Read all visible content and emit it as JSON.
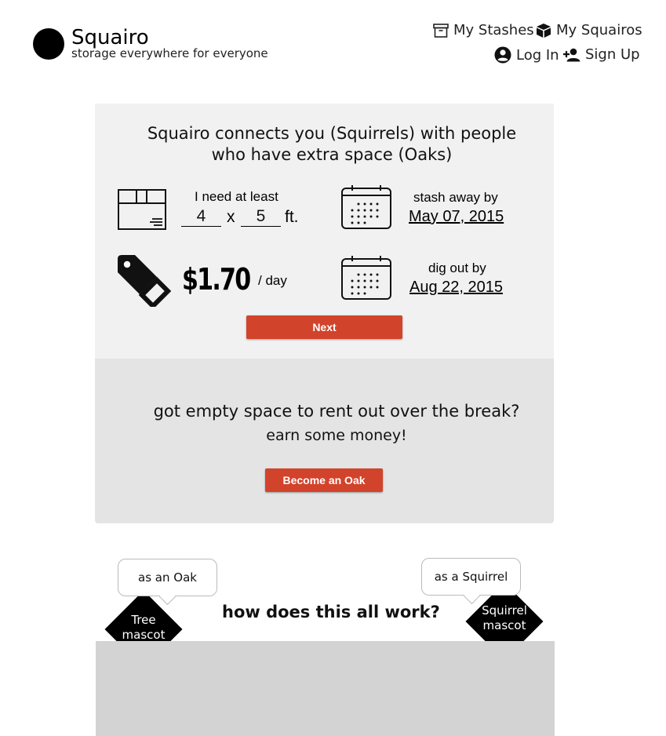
{
  "header": {
    "brand": "Squairo",
    "tagline": "storage everywhere for everyone",
    "nav": {
      "stashes": "My Stashes",
      "squairos": "My Squairos",
      "login": "Log In",
      "signup": "Sign Up"
    }
  },
  "hero": {
    "headline_line1": "Squairo connects you (Squirrels) with people",
    "headline_line2": "who have extra space (Oaks)",
    "size": {
      "label": "I need at least",
      "width": "4",
      "by": "x",
      "length": "5",
      "unit": "ft."
    },
    "price": {
      "amount": "$1.70",
      "period": "/ day"
    },
    "stash": {
      "label": "stash away by",
      "date": "May 07, 2015"
    },
    "dig": {
      "label": "dig out by",
      "date": "Aug 22, 2015"
    },
    "next_label": "Next"
  },
  "oak_cta": {
    "line1": "got empty space to rent out over the break?",
    "line2": "earn some money!",
    "button_label": "Become an Oak"
  },
  "how": {
    "title": "how does this all work?",
    "oak_bubble": "as an Oak",
    "squirrel_bubble": "as a Squirrel",
    "tree_mascot_line1": "Tree",
    "tree_mascot_line2": "mascot",
    "squirrel_mascot_line1": "Squirrel",
    "squirrel_mascot_line2": "mascot"
  },
  "colors": {
    "accent_red": "#d2432b",
    "panel_light": "#f1f1f1",
    "panel_mid": "#e4e4e4",
    "panel_dark": "#d3d3d3"
  },
  "icons": [
    "logo-circle",
    "archive-box-icon",
    "cube-icon",
    "account-circle-icon",
    "person-add-icon",
    "package-box-icon",
    "calendar-icon",
    "price-tag-icon"
  ]
}
